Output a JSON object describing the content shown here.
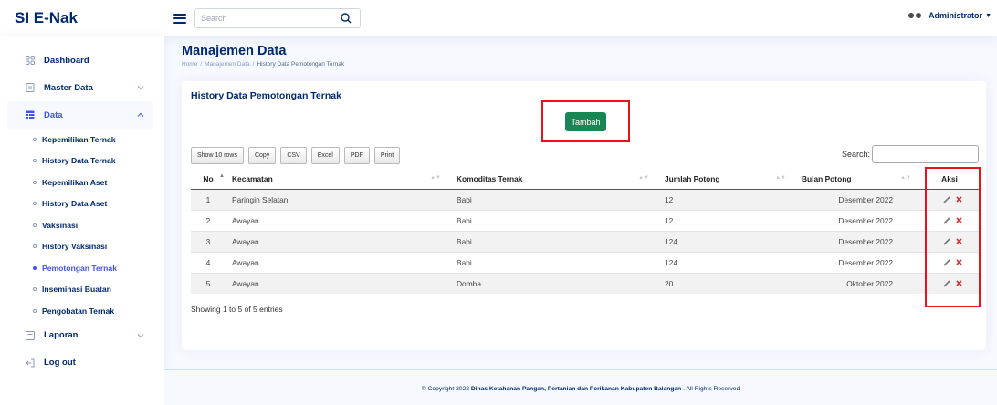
{
  "app": {
    "title": "SI E-Nak"
  },
  "header": {
    "search_placeholder": "Search",
    "user_name": "Administrator"
  },
  "sidebar": {
    "items": [
      {
        "label": "Dashboard",
        "icon": "grid-icon"
      },
      {
        "label": "Master Data",
        "icon": "document-icon"
      },
      {
        "label": "Data",
        "icon": "table-icon",
        "active": true
      },
      {
        "label": "Laporan",
        "icon": "report-icon"
      },
      {
        "label": "Log out",
        "icon": "logout-icon"
      }
    ],
    "data_subitems": [
      {
        "label": "Kepemilikan Ternak"
      },
      {
        "label": "History Data Ternak"
      },
      {
        "label": "Kepemilikan Aset"
      },
      {
        "label": "History Data Aset"
      },
      {
        "label": "Vaksinasi"
      },
      {
        "label": "History Vaksinasi"
      },
      {
        "label": "Pemotongan Ternak",
        "active": true
      },
      {
        "label": "Inseminasi Buatan"
      },
      {
        "label": "Pengobatan Ternak"
      }
    ]
  },
  "page": {
    "title": "Manajemen Data",
    "breadcrumb": [
      "Home",
      "/",
      "Manajemen Data",
      "/",
      "History Data Pemotongan Ternak"
    ]
  },
  "card": {
    "title": "History Data Pemotongan Ternak",
    "add_button": "Tambah",
    "export_buttons": [
      "Show 10 rows",
      "Copy",
      "CSV",
      "Excel",
      "PDF",
      "Print"
    ],
    "search_label": "Search:",
    "columns": [
      "No",
      "Kecamatan",
      "Komoditas Ternak",
      "Jumlah Potong",
      "Bulan Potong",
      "Aksi"
    ],
    "rows": [
      {
        "no": "1",
        "kecamatan": "Paringin Selatan",
        "komoditas": "Babi",
        "jumlah": "12",
        "bulan": "Desember 2022"
      },
      {
        "no": "2",
        "kecamatan": "Awayan",
        "komoditas": "Babi",
        "jumlah": "12",
        "bulan": "Desember 2022"
      },
      {
        "no": "3",
        "kecamatan": "Awayan",
        "komoditas": "Babi",
        "jumlah": "124",
        "bulan": "Desember 2022"
      },
      {
        "no": "4",
        "kecamatan": "Awayan",
        "komoditas": "Babi",
        "jumlah": "124",
        "bulan": "Desember 2022"
      },
      {
        "no": "5",
        "kecamatan": "Awayan",
        "komoditas": "Domba",
        "jumlah": "20",
        "bulan": "Oktober 2022"
      }
    ],
    "info": "Showing 1 to 5 of 5 entries"
  },
  "footer": {
    "prefix": "© Copyright 2022",
    "org": "Dinas Ketahanan Pangan, Pertanian dan Perikanan Kabupaten Balangan",
    "suffix": ". All Rights Reserved"
  },
  "colors": {
    "primary": "#012970",
    "accent": "#4154f1",
    "success": "#198754",
    "highlight": "#e6131b"
  }
}
